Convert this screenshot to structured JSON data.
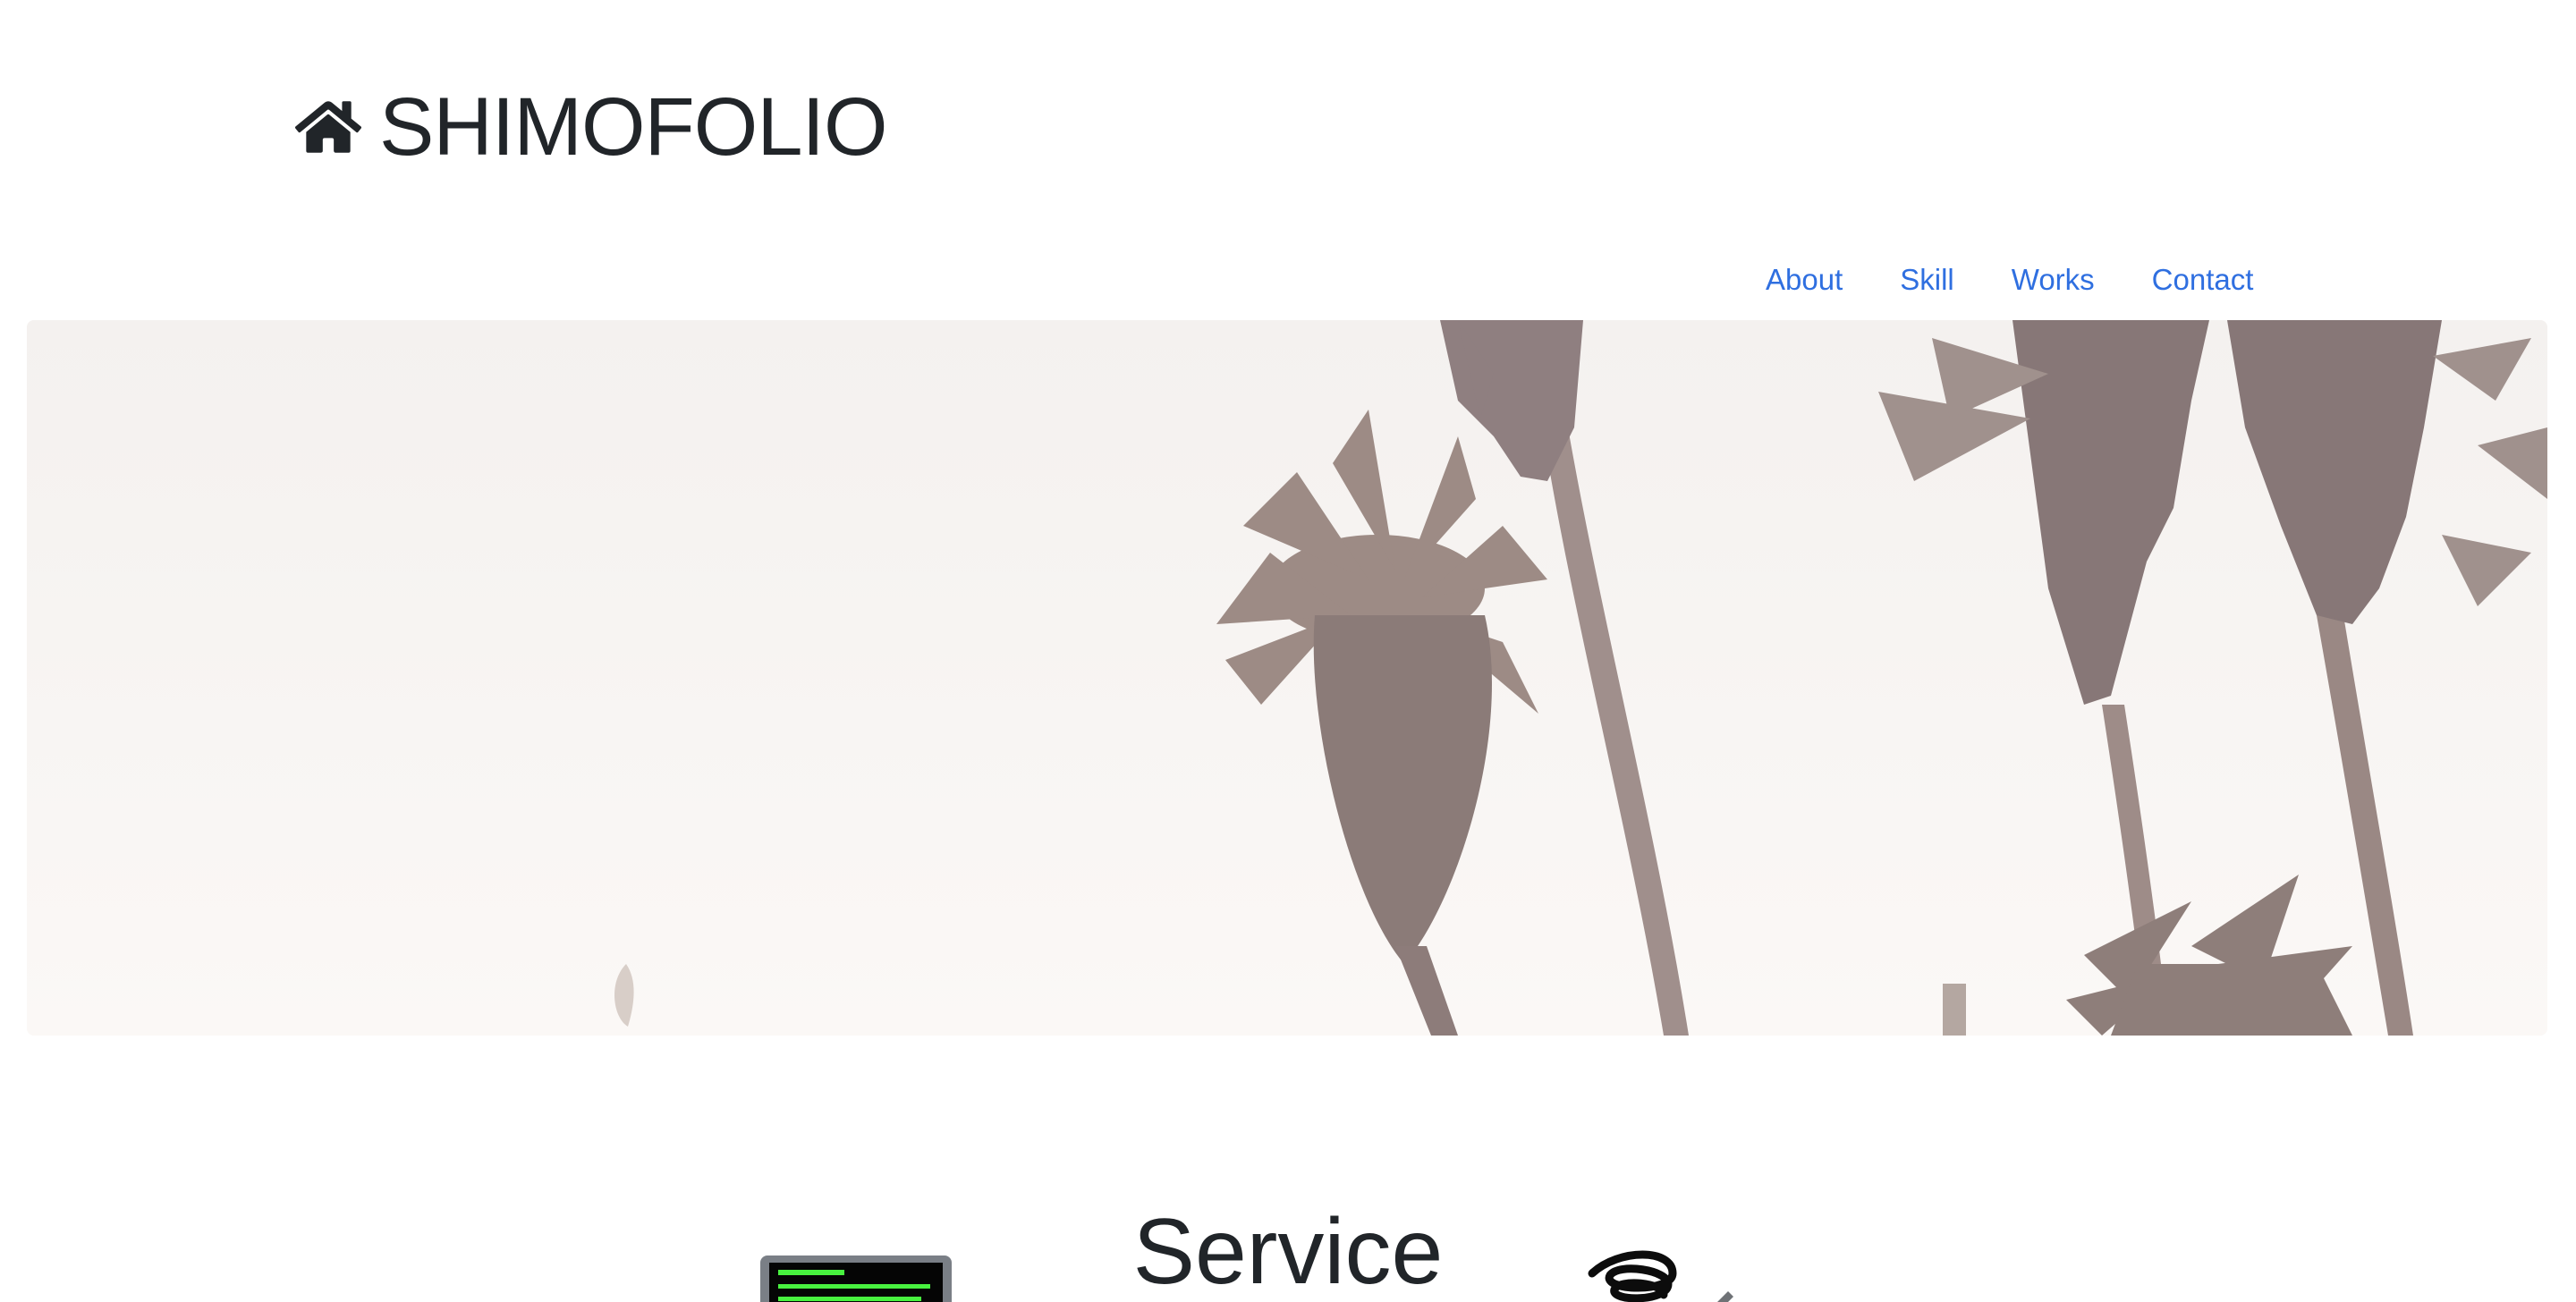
{
  "header": {
    "brand": "SHIMOFOLIO",
    "icon": "home-icon"
  },
  "nav": {
    "items": [
      {
        "label": "About"
      },
      {
        "label": "Skill"
      },
      {
        "label": "Works"
      },
      {
        "label": "Contact"
      }
    ],
    "link_color": "#2f6fe0"
  },
  "hero": {
    "image": "palm-trees-photo"
  },
  "service": {
    "title": "Service",
    "icons": [
      "terminal-icon",
      "pen-scribble-icon"
    ]
  }
}
